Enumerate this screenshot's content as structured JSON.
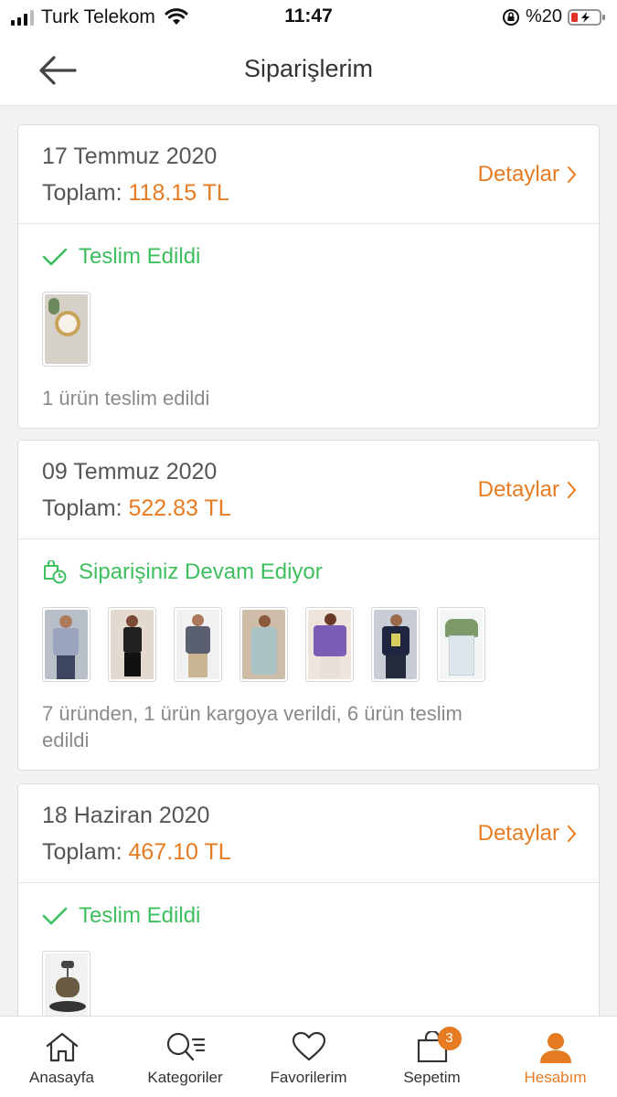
{
  "status_bar": {
    "carrier": "Turk Telekom",
    "time": "11:47",
    "battery": "%20"
  },
  "header": {
    "title": "Siparişlerim"
  },
  "orders": [
    {
      "date": "17 Temmuz 2020",
      "total_label": "Toplam:",
      "total_value": "118.15 TL",
      "details_label": "Detaylar",
      "status": "Teslim Edildi",
      "status_icon": "check-icon",
      "summary": "1 ürün teslim edildi",
      "items": [
        {
          "name": "clock-decor-thumb",
          "color": "#d9d3c8"
        }
      ]
    },
    {
      "date": "09 Temmuz 2020",
      "total_label": "Toplam:",
      "total_value": "522.83 TL",
      "details_label": "Detaylar",
      "status": "Siparişiniz Devam Ediyor",
      "status_icon": "order-clock-icon",
      "summary": "7 üründen, 1 ürün kargoya verildi, 6 ürün teslim edildi",
      "items": [
        {
          "name": "tshirt-grey-thumb",
          "color": "#9aa3b5"
        },
        {
          "name": "woman-black-outfit-thumb",
          "color": "#d8cfc6"
        },
        {
          "name": "patterned-shirt-thumb",
          "color": "#e8e8e8"
        },
        {
          "name": "woman-jumpsuit-thumb",
          "color": "#c9b9a6"
        },
        {
          "name": "purple-leader-tshirt-thumb",
          "color": "#7a5db5"
        },
        {
          "name": "navy-tshirt-thumb",
          "color": "#2e3550"
        },
        {
          "name": "white-box-thumb",
          "color": "#eceff0"
        }
      ]
    },
    {
      "date": "18 Haziran 2020",
      "total_label": "Toplam:",
      "total_value": "467.10 TL",
      "details_label": "Detaylar",
      "status": "Teslim Edildi",
      "status_icon": "check-icon",
      "summary": "",
      "items": [
        {
          "name": "swing-chair-thumb",
          "color": "#e9e9e9"
        }
      ]
    }
  ],
  "tabs": [
    {
      "label": "Anasayfa",
      "icon": "home-icon",
      "active": false
    },
    {
      "label": "Kategoriler",
      "icon": "category-search-icon",
      "active": false
    },
    {
      "label": "Favorilerim",
      "icon": "heart-icon",
      "active": false
    },
    {
      "label": "Sepetim",
      "icon": "bag-icon",
      "active": false,
      "badge": "3"
    },
    {
      "label": "Hesabım",
      "icon": "user-icon",
      "active": true
    }
  ],
  "colors": {
    "accent": "#e77b22",
    "success": "#3dbf5e"
  }
}
